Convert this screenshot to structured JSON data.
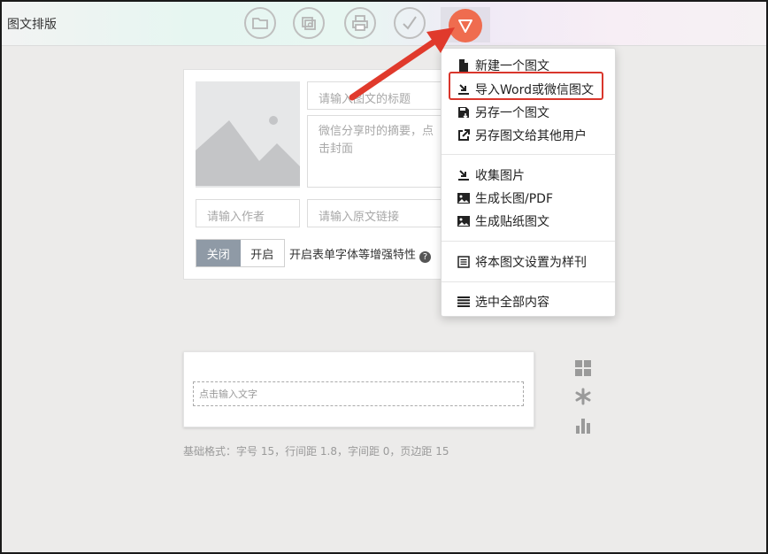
{
  "app": {
    "title": "图文排版"
  },
  "editor": {
    "title_placeholder": "请输入图文的标题",
    "summary_placeholder": "微信分享时的摘要，点击封面",
    "author_placeholder": "请输入作者",
    "source_placeholder": "请输入原文链接",
    "toggle_off": "关闭",
    "toggle_on": "开启",
    "toggle_label": "开启表单字体等增强特性",
    "help_glyph": "?"
  },
  "text_block": {
    "placeholder": "点击输入文字",
    "format_info": "基础格式：字号 15，行间距 1.8，字间距 0，页边距 15"
  },
  "menu": {
    "items": [
      {
        "label": "新建一个图文",
        "icon": "file-icon"
      },
      {
        "label": "导入Word或微信图文",
        "icon": "import-icon"
      },
      {
        "label": "另存一个图文",
        "icon": "save-as-icon"
      },
      {
        "label": "另存图文给其他用户",
        "icon": "share-icon"
      },
      {
        "label": "收集图片",
        "icon": "collect-icon"
      },
      {
        "label": "生成长图/PDF",
        "icon": "image-icon"
      },
      {
        "label": "生成贴纸图文",
        "icon": "image-icon"
      },
      {
        "label": "将本图文设置为样刊",
        "icon": "list-icon"
      },
      {
        "label": "选中全部内容",
        "icon": "menu-icon"
      }
    ]
  },
  "colors": {
    "accent": "#ef6c4f",
    "highlight": "#d9362c",
    "toggle_off_bg": "#8f9aa6"
  }
}
